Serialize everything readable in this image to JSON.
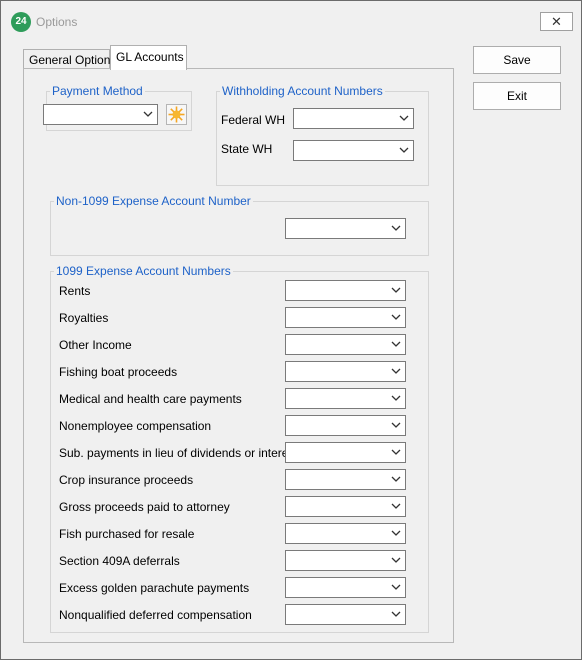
{
  "window": {
    "title": "Options",
    "app_icon_text": "24",
    "close_glyph": "✕"
  },
  "tabs": [
    {
      "label": "General Options",
      "active": false
    },
    {
      "label": "GL Accounts",
      "active": true
    }
  ],
  "payment_method": {
    "title": "Payment Method",
    "value": "",
    "add_icon": "sun-icon"
  },
  "withholding": {
    "title": "Withholding Account Numbers",
    "federal_label": "Federal WH",
    "federal_value": "",
    "state_label": "State WH",
    "state_value": ""
  },
  "non1099": {
    "title": "Non-1099 Expense Account Number",
    "value": ""
  },
  "expense1099": {
    "title": "1099 Expense Account Numbers",
    "rows": [
      {
        "label": "Rents",
        "value": ""
      },
      {
        "label": "Royalties",
        "value": ""
      },
      {
        "label": "Other Income",
        "value": ""
      },
      {
        "label": "Fishing boat proceeds",
        "value": ""
      },
      {
        "label": "Medical and health care payments",
        "value": ""
      },
      {
        "label": "Nonemployee compensation",
        "value": ""
      },
      {
        "label": "Sub. payments in lieu of dividends or interest",
        "value": ""
      },
      {
        "label": "Crop insurance proceeds",
        "value": ""
      },
      {
        "label": "Gross proceeds paid to attorney",
        "value": ""
      },
      {
        "label": "Fish purchased for resale",
        "value": ""
      },
      {
        "label": "Section 409A deferrals",
        "value": ""
      },
      {
        "label": "Excess golden parachute payments",
        "value": ""
      },
      {
        "label": "Nonqualified deferred compensation",
        "value": ""
      }
    ]
  },
  "buttons": {
    "save": "Save",
    "exit": "Exit"
  },
  "colors": {
    "group_title": "#1e62c8",
    "app_icon": "#2e9c5a",
    "sun": "#f5a623"
  }
}
